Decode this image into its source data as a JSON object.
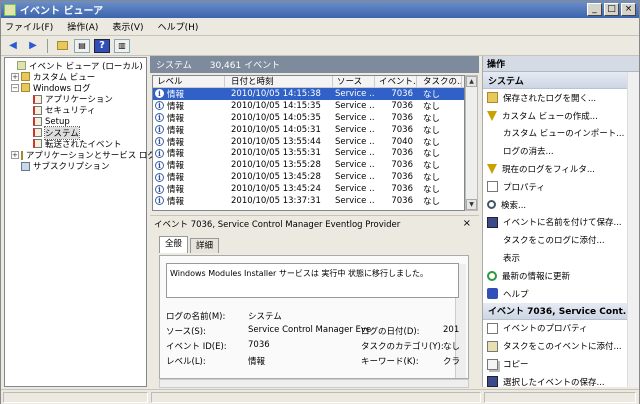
{
  "window": {
    "title": "イベント ビューア",
    "min": "_",
    "max": "□",
    "close": "×"
  },
  "menu": [
    "ファイル(F)",
    "操作(A)",
    "表示(V)",
    "ヘルプ(H)"
  ],
  "toolbar": {
    "back": "◀",
    "forward": "▶",
    "help": "?"
  },
  "tree": {
    "root": "イベント ビューア (ローカル)",
    "custom_views": "カスタム ビュー",
    "windows_logs": "Windows ログ",
    "application": "アプリケーション",
    "security": "セキュリティ",
    "setup": "Setup",
    "system": "システム",
    "forwarded": "転送されたイベント",
    "apps_services": "アプリケーションとサービス ログ",
    "subscriptions": "サブスクリプション",
    "expanded_glyph": "−",
    "collapsed_glyph": "+"
  },
  "middle": {
    "title": "システム",
    "count": "30,461 イベント"
  },
  "event_list": {
    "columns": [
      "レベル",
      "日付と時刻",
      "ソース",
      "イベント...",
      "タスクの..."
    ],
    "rows": [
      {
        "level": "情報",
        "datetime": "2010/10/05 14:15:38",
        "source": "Service ...",
        "id": "7036",
        "task": "なし",
        "selected": true
      },
      {
        "level": "情報",
        "datetime": "2010/10/05 14:15:35",
        "source": "Service ...",
        "id": "7036",
        "task": "なし"
      },
      {
        "level": "情報",
        "datetime": "2010/10/05 14:05:35",
        "source": "Service ...",
        "id": "7036",
        "task": "なし"
      },
      {
        "level": "情報",
        "datetime": "2010/10/05 14:05:31",
        "source": "Service ...",
        "id": "7036",
        "task": "なし"
      },
      {
        "level": "情報",
        "datetime": "2010/10/05 13:55:44",
        "source": "Service ...",
        "id": "7040",
        "task": "なし"
      },
      {
        "level": "情報",
        "datetime": "2010/10/05 13:55:31",
        "source": "Service ...",
        "id": "7036",
        "task": "なし"
      },
      {
        "level": "情報",
        "datetime": "2010/10/05 13:55:28",
        "source": "Service ...",
        "id": "7036",
        "task": "なし"
      },
      {
        "level": "情報",
        "datetime": "2010/10/05 13:45:28",
        "source": "Service ...",
        "id": "7036",
        "task": "なし"
      },
      {
        "level": "情報",
        "datetime": "2010/10/05 13:45:24",
        "source": "Service ...",
        "id": "7036",
        "task": "なし"
      },
      {
        "level": "情報",
        "datetime": "2010/10/05 13:37:31",
        "source": "Service ...",
        "id": "7036",
        "task": "なし"
      }
    ],
    "info_glyph": "i",
    "scroll_up": "▲",
    "scroll_down": "▼"
  },
  "detail": {
    "title": "イベント 7036, Service Control Manager Eventlog Provider",
    "close": "×",
    "tabs": [
      "全般",
      "詳細"
    ],
    "message": "Windows Modules Installer サービスは 実行中 状態に移行しました。",
    "log_name_label": "ログの名前(M):",
    "log_name_value": "システム",
    "source_label": "ソース(S):",
    "source_value": "Service Control Manager Eve",
    "logged_label": "ログの日付(D):",
    "logged_value": "201",
    "event_id_label": "イベント ID(E):",
    "event_id_value": "7036",
    "task_cat_label": "タスクのカテゴリ(Y):",
    "task_cat_value": "なし",
    "level_label": "レベル(L):",
    "level_value": "情報",
    "keywords_label": "キーワード(K):",
    "keywords_value": "クラ"
  },
  "actions": {
    "header": "操作",
    "section1": "システム",
    "section1_items": [
      {
        "label": "保存されたログを開く...",
        "icon": "open-log-icon"
      },
      {
        "label": "カスタム ビューの作成...",
        "icon": "filter-icon"
      },
      {
        "label": "カスタム ビューのインポート...",
        "icon": "none"
      },
      {
        "label": "ログの消去...",
        "icon": "none"
      },
      {
        "label": "現在のログをフィルタ...",
        "icon": "filter-icon"
      },
      {
        "label": "プロパティ",
        "icon": "properties-icon"
      },
      {
        "label": "検索...",
        "icon": "find-icon"
      },
      {
        "label": "イベントに名前を付けて保存...",
        "icon": "save-icon"
      },
      {
        "label": "タスクをこのログに添付...",
        "icon": "none"
      },
      {
        "label": "表示",
        "icon": "none",
        "submenu": true
      },
      {
        "label": "最新の情報に更新",
        "icon": "refresh-icon"
      },
      {
        "label": "ヘルプ",
        "icon": "help-icon",
        "submenu": true
      }
    ],
    "section2": "イベント 7036, Service Cont...",
    "section2_items": [
      {
        "label": "イベントのプロパティ",
        "icon": "properties-icon"
      },
      {
        "label": "タスクをこのイベントに添付...",
        "icon": "task-icon"
      },
      {
        "label": "コピー",
        "icon": "copy-icon",
        "submenu": true
      },
      {
        "label": "選択したイベントの保存...",
        "icon": "save-icon"
      }
    ],
    "collapse_glyph": "▲",
    "submenu_glyph": "▶"
  }
}
